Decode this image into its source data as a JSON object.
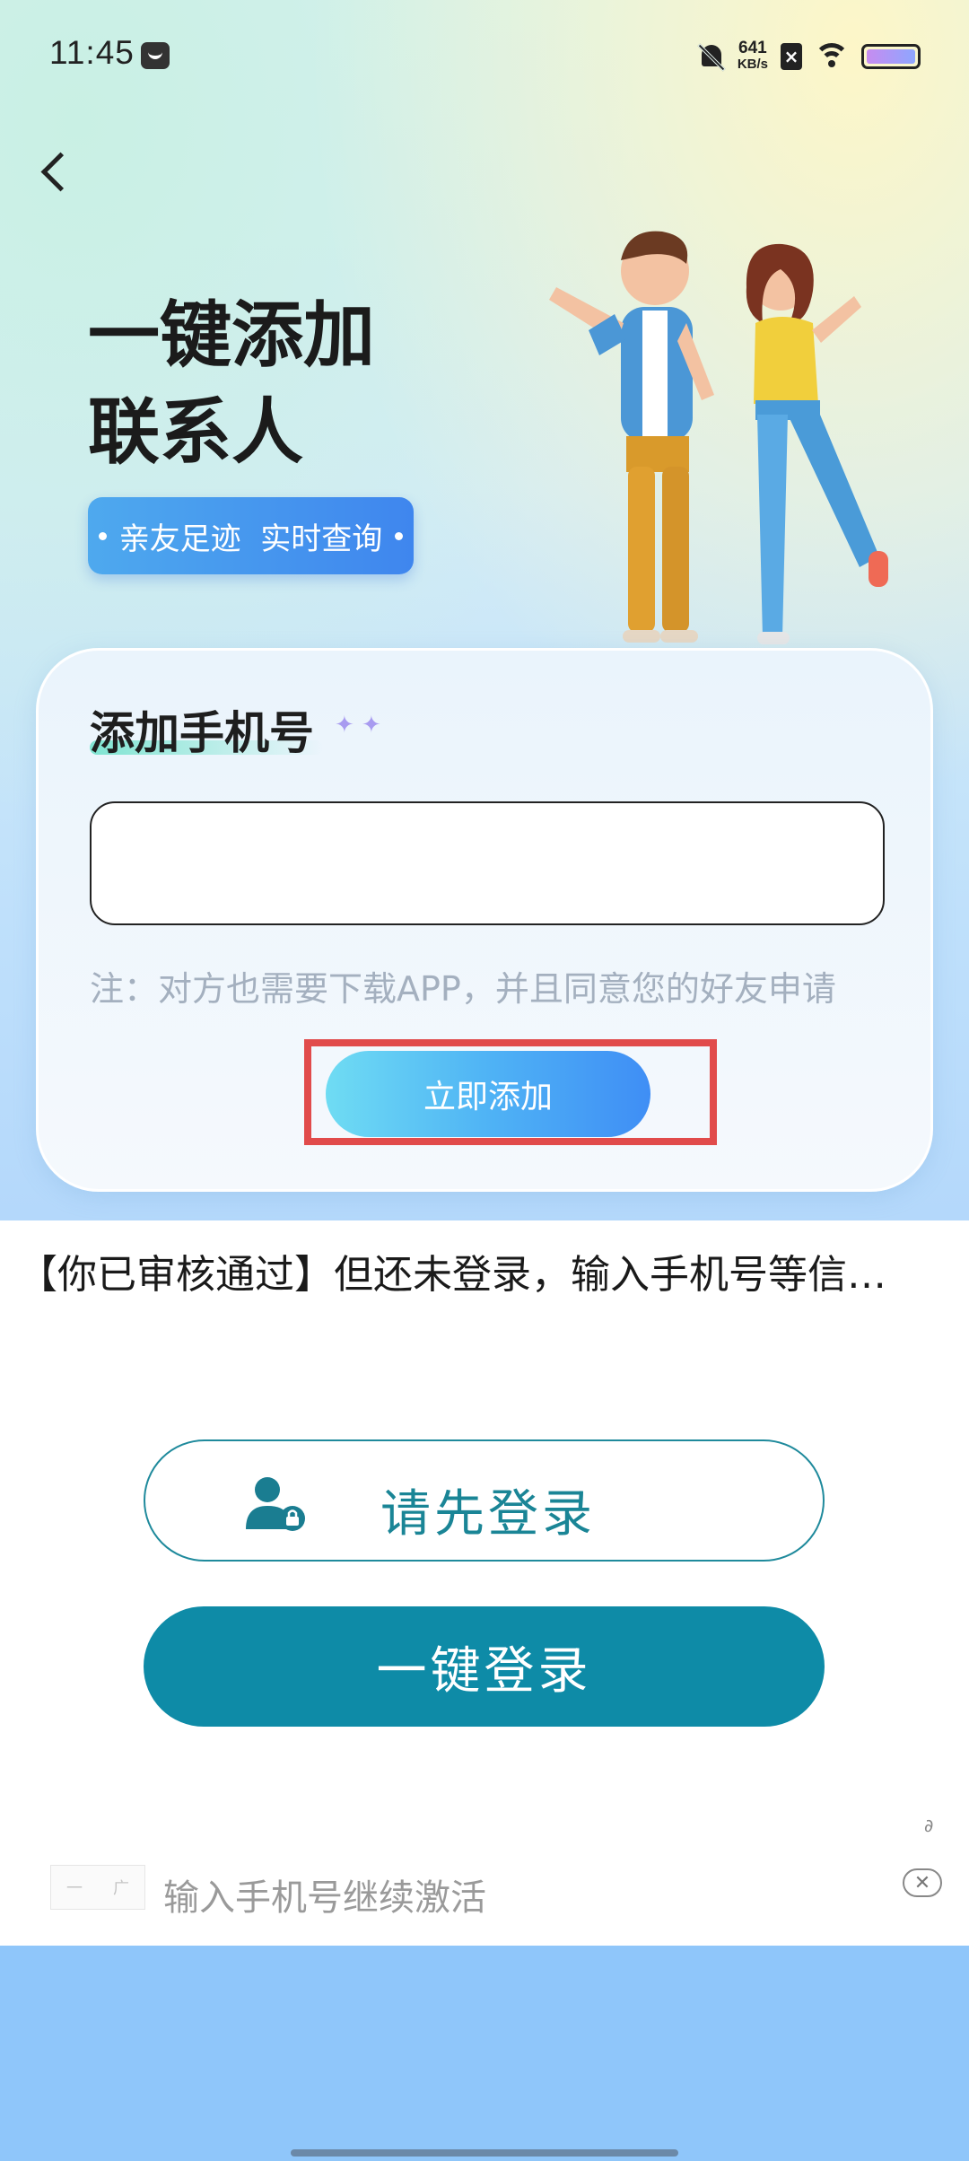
{
  "status_bar": {
    "time": "11:45",
    "net_speed_value": "641",
    "net_speed_unit": "KB/s",
    "icons": [
      "app-notification-icon",
      "bell-off-icon",
      "sim-blocked-icon",
      "wifi-icon",
      "battery-icon"
    ]
  },
  "header": {
    "headline_line1": "一键添加",
    "headline_line2": "联系人",
    "pill_text": "亲友足迹  实时查询"
  },
  "card": {
    "title": "添加手机号",
    "sparkles": "✦ ✦",
    "phone_input_value": "",
    "phone_input_placeholder": "",
    "note": "注：对方也需要下载APP，并且同意您的好友申请",
    "add_button_label": "立即添加"
  },
  "login": {
    "notice": "【你已审核通过】但还未登录，输入手机号等信…",
    "login_first_label": "请先登录",
    "one_click_label": "一键登录"
  },
  "ad": {
    "logo_text_left": "一",
    "logo_text_right": "广",
    "text": "输入手机号继续激活",
    "close_symbol": "✕"
  },
  "colors": {
    "accent_teal": "#0e8ba7",
    "pill_blue": "#3f86ee",
    "highlight_red": "#e14b4b",
    "bottom_blue": "#8fc6fa"
  }
}
